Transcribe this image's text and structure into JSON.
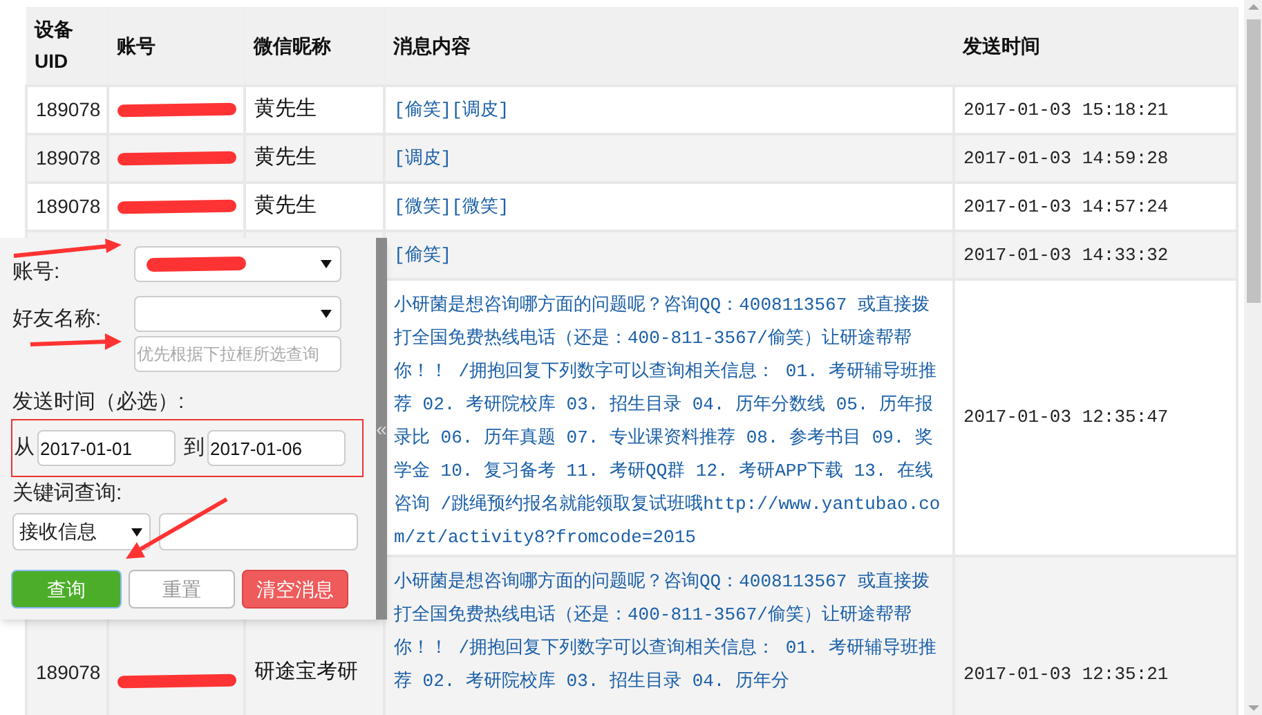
{
  "table": {
    "columns": [
      "设备UID",
      "账号",
      "微信昵称",
      "消息内容",
      "发送时间"
    ],
    "rows": [
      {
        "uid": "189078",
        "nickname": "黄先生",
        "message": "[偷笑][调皮]",
        "time": "2017-01-03 15:18:21"
      },
      {
        "uid": "189078",
        "nickname": "黄先生",
        "message": "[调皮]",
        "time": "2017-01-03 14:59:28"
      },
      {
        "uid": "189078",
        "nickname": "黄先生",
        "message": "[微笑][微笑]",
        "time": "2017-01-03 14:57:24"
      },
      {
        "message": "[偷笑]",
        "time": "2017-01-03 14:33:32"
      },
      {
        "message": "小研菌是想咨询哪方面的问题呢？咨询QQ：4008113567 或直接拨打全国免费热线电话（还是：400-811-3567/偷笑）让研途帮帮你！！ /拥抱回复下列数字可以查询相关信息： 01. 考研辅导班推荐 02. 考研院校库 03. 招生目录 04. 历年分数线 05. 历年报录比 06. 历年真题 07. 专业课资料推荐 08. 参考书目 09. 奖学金 10. 复习备考 11. 考研QQ群 12. 考研APP下载 13. 在线咨询 /跳绳预约报名就能领取复试班哦http://www.yantubao.com/zt/activity8?fromcode=2015",
        "time": "2017-01-03 12:35:47"
      },
      {
        "uid": "189078",
        "nickname": "研途宝考研",
        "message": "小研菌是想咨询哪方面的问题呢？咨询QQ：4008113567 或直接拨打全国免费热线电话（还是：400-811-3567/偷笑）让研途帮帮你！！ /拥抱回复下列数字可以查询相关信息： 01. 考研辅导班推荐 02. 考研院校库 03. 招生目录 04. 历年分",
        "time": "2017-01-03 12:35:21"
      }
    ]
  },
  "filter_panel": {
    "account_label": "账号:",
    "friend_label": "好友名称:",
    "friend_placeholder": "优先根据下拉框所选查询",
    "time_label": "发送时间（必选）:",
    "from_label": "从",
    "from_value": "2017-01-01",
    "to_label": "到",
    "to_value": "2017-01-06",
    "keyword_label": "关键词查询:",
    "keyword_type": "接收信息",
    "buttons": [
      {
        "label": "查询",
        "kind": "primary"
      },
      {
        "label": "重置",
        "kind": "default"
      },
      {
        "label": "清空消息",
        "kind": "danger"
      }
    ],
    "collapse_handle": "«"
  }
}
